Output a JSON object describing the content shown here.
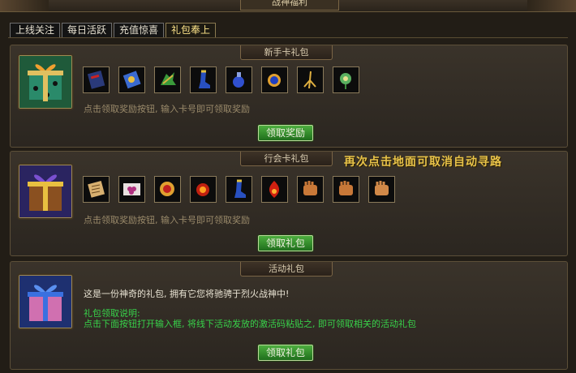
{
  "window": {
    "title": "战神福利"
  },
  "tabs": [
    {
      "label": "上线关注"
    },
    {
      "label": "每日活跃"
    },
    {
      "label": "充值惊喜"
    },
    {
      "label": "礼包奉上"
    }
  ],
  "active_tab": "礼包奉上",
  "overlay_text": "再次点击地面可取消自动寻路",
  "panels": [
    {
      "title": "新手卡礼包",
      "icon": "gift-box-green-icon",
      "items": [
        "scroll-book-icon",
        "blue-scroll-icon",
        "green-claw-icon",
        "blue-boots-icon",
        "blue-potion-icon",
        "blue-amulet-icon",
        "gold-root-icon",
        "green-flower-icon"
      ],
      "desc": "点击领取奖励按钮, 输入卡号即可领取奖励",
      "button": "领取奖励"
    },
    {
      "title": "行会卡礼包",
      "icon": "gift-box-purple-icon",
      "items": [
        "parchment-icon",
        "grapes-icon",
        "red-gem-icon",
        "fire-orb-icon",
        "blue-boots-icon",
        "red-flame-icon",
        "fist-icon",
        "fist-icon",
        "fist-icon"
      ],
      "desc": "点击领取奖励按钮, 输入卡号即可领取奖励",
      "button": "领取礼包"
    },
    {
      "title": "活动礼包",
      "icon": "gift-box-pink-icon",
      "desc": "这是一份神奇的礼包, 拥有它您将驰骋于烈火战神中!",
      "note_title": "礼包领取说明:",
      "note": "点击下面按钮打开输入框, 将线下活动发放的激活码粘贴之, 即可领取相关的活动礼包",
      "button": "领取礼包"
    }
  ],
  "colors": {
    "accent_green": "#38d14a",
    "gold": "#e8c34a",
    "active_tab": "#ffe58a"
  }
}
